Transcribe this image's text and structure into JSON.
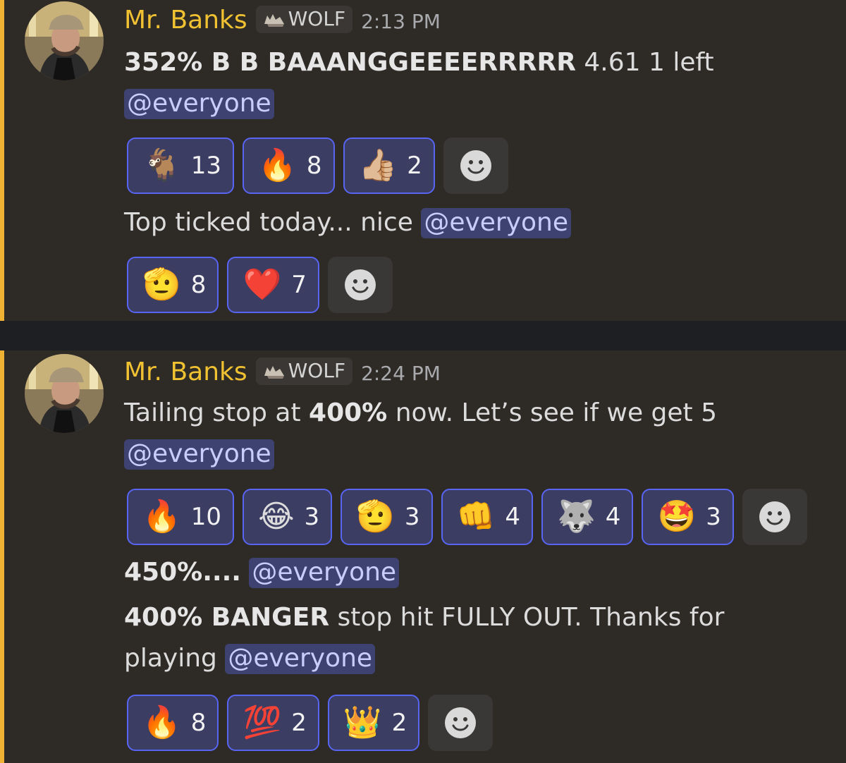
{
  "messages": [
    {
      "author": "Mr. Banks",
      "role_tag": "WOLF",
      "time": "2:13 PM",
      "text_bold": "352% B B BAAANGGEEEERRRRR",
      "text_rest": " 4.61 1 left",
      "mention": "@everyone",
      "reactions": [
        {
          "emoji": "🐐",
          "count": "13"
        },
        {
          "emoji": "🔥",
          "count": "8"
        },
        {
          "emoji": "👍🏼",
          "count": "2"
        }
      ],
      "followup": {
        "text": "Top ticked today... nice ",
        "mention": "@everyone",
        "reactions": [
          {
            "emoji": "🫡",
            "count": "8"
          },
          {
            "emoji": "❤️",
            "count": "7"
          }
        ]
      }
    },
    {
      "author": "Mr. Banks",
      "role_tag": "WOLF",
      "time": "2:24 PM",
      "text_pre": "Tailing stop at ",
      "text_bold": "400%",
      "text_post": " now. Let’s see if we get 5",
      "mention": "@everyone",
      "reactions": [
        {
          "emoji": "🔥",
          "count": "10"
        },
        {
          "emoji": "😂",
          "count": "3"
        },
        {
          "emoji": "🫡",
          "count": "3"
        },
        {
          "emoji": "👊",
          "count": "4"
        },
        {
          "emoji": "🐺",
          "count": "4"
        },
        {
          "emoji": "🤩",
          "count": "3"
        }
      ],
      "followup1": {
        "text_bold": "450%....",
        "mention": "@everyone"
      },
      "followup2": {
        "text_bold": "400% BANGER",
        "text_rest": " stop hit FULLY OUT. Thanks for",
        "text_line2": "playing ",
        "mention": "@everyone",
        "reactions": [
          {
            "emoji": "🔥",
            "count": "8"
          },
          {
            "emoji": "💯",
            "count": "2"
          },
          {
            "emoji": "👑",
            "count": "2"
          }
        ]
      }
    }
  ],
  "icons": {
    "role_icon": "wolf-icon",
    "add_reaction": "smiley-add-reaction-icon"
  },
  "colors": {
    "accent_bar": "#f0b232",
    "author": "#f0c232",
    "mention_bg": "#3d4270",
    "reaction_border": "#5865f2"
  }
}
